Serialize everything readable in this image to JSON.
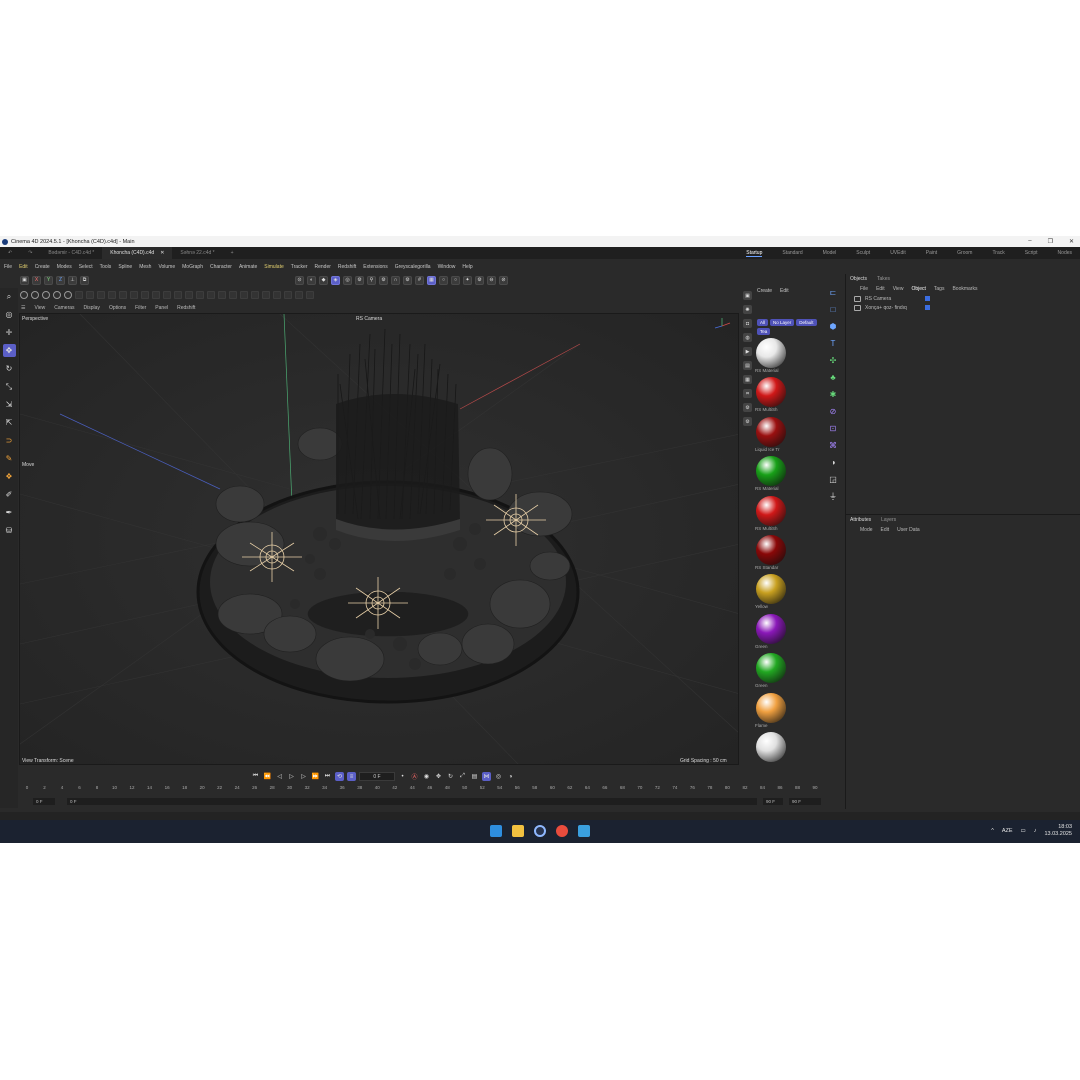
{
  "window": {
    "title": "Cinema 4D 2024.5.1 - [Khoncha (C4D).c4d] - Main",
    "minimize": "–",
    "maximize": "❐",
    "close": "✕"
  },
  "tabs": [
    {
      "label": "Bədəmir - C4D.c4d *",
      "close": ""
    },
    {
      "label": "Khoncha (C4D).c4d",
      "close": "✕"
    },
    {
      "label": "Səhnə 22.c4d *",
      "close": ""
    }
  ],
  "add_tab": "+",
  "layouts": [
    "Startup",
    "Standard",
    "Model",
    "Sculpt",
    "UVEdit",
    "Paint",
    "Groom",
    "Track",
    "Script",
    "Nodes"
  ],
  "menu": [
    "File",
    "Edit",
    "Create",
    "Modes",
    "Select",
    "Tools",
    "Spline",
    "Mesh",
    "Volume",
    "MoGraph",
    "Character",
    "Animate",
    "Simulate",
    "Tracker",
    "Render",
    "Redshift",
    "Extensions",
    "Greyscalegorilla",
    "Window",
    "Help"
  ],
  "view_menu": [
    "View",
    "Cameras",
    "Display",
    "Options",
    "Filter",
    "Panel",
    "Redshift"
  ],
  "viewport": {
    "name": "Perspective",
    "camera": "RS Camera",
    "mode": "Move",
    "view_transform": "View Transform: Scene",
    "grid_spacing": "Grid Spacing : 50 cm"
  },
  "toolbar_xyz": [
    "X",
    "Y",
    "Z"
  ],
  "materials": {
    "menu": [
      "Create",
      "Edit"
    ],
    "filters": [
      "All",
      "No Layer",
      "Default",
      "Tea"
    ],
    "items": [
      {
        "name": "RS Material",
        "color": "#e8e8e8"
      },
      {
        "name": "RS MultiSh",
        "color": "#d01818"
      },
      {
        "name": "Liquid Ice Tr",
        "color": "#9a1010"
      },
      {
        "name": "RS Material",
        "color": "#18a018"
      },
      {
        "name": "RS MultiSh",
        "color": "#d01818"
      },
      {
        "name": "RS Standar",
        "color": "#8a0808"
      },
      {
        "name": "Yellow",
        "color": "#c8a020"
      },
      {
        "name": "Green",
        "color": "#8a18b8"
      },
      {
        "name": "Green",
        "color": "#22a822"
      },
      {
        "name": "Flame",
        "color": "#f0a040"
      },
      {
        "name": "",
        "color": "#e0e0e0"
      }
    ]
  },
  "objects": {
    "tabs": [
      "Objects",
      "Takes"
    ],
    "menu": [
      "File",
      "Edit",
      "View",
      "Object",
      "Tags",
      "Bookmarks"
    ],
    "rows": [
      "RS Camera",
      "Xonça+ qoz- findıq"
    ]
  },
  "attributes": {
    "tabs": [
      "Attributes",
      "Layers"
    ],
    "menu": [
      "Mode",
      "Edit",
      "User Data"
    ]
  },
  "timeline": {
    "current_frame": "0 F",
    "start": "0 F",
    "start2": "0 F",
    "end": "90 F",
    "end2": "90 F",
    "ticks": [
      "0",
      "2",
      "4",
      "6",
      "8",
      "10",
      "12",
      "14",
      "16",
      "18",
      "20",
      "22",
      "24",
      "26",
      "28",
      "30",
      "32",
      "34",
      "36",
      "38",
      "40",
      "42",
      "44",
      "46",
      "48",
      "50",
      "52",
      "54",
      "56",
      "58",
      "60",
      "62",
      "64",
      "66",
      "68",
      "70",
      "72",
      "74",
      "76",
      "78",
      "80",
      "82",
      "84",
      "86",
      "88",
      "90"
    ]
  },
  "taskbar": {
    "lang": "AZE",
    "time": "18:03",
    "date": "13.03.2025"
  }
}
